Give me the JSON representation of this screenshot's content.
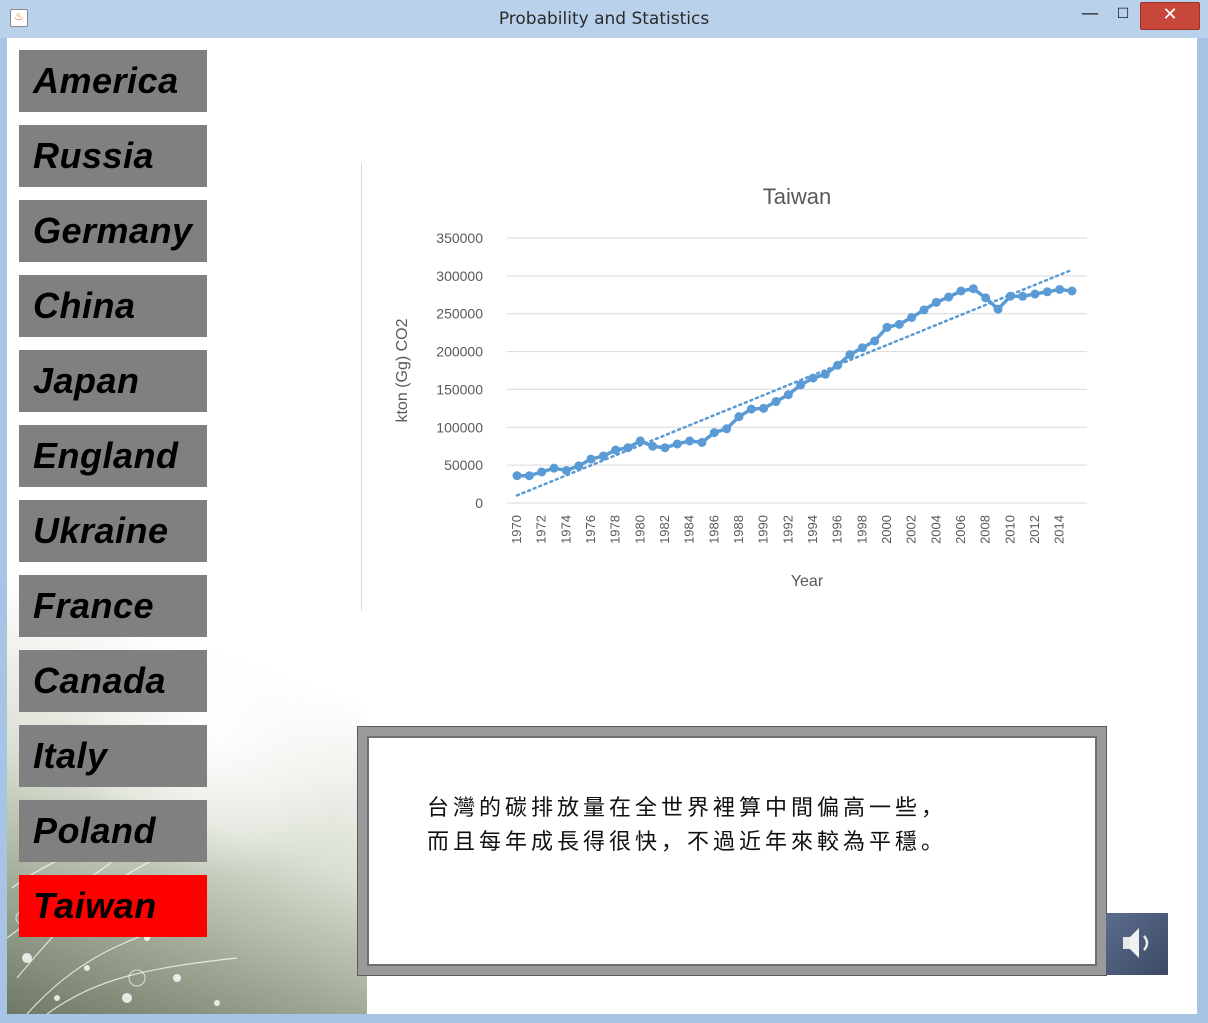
{
  "window": {
    "title": "Probability and Statistics",
    "icon": "java-cup-icon",
    "controls": {
      "minimize": "—",
      "maximize": "☐",
      "close": "✕"
    }
  },
  "sidebar": {
    "items": [
      {
        "label": "America",
        "active": false
      },
      {
        "label": "Russia",
        "active": false
      },
      {
        "label": "Germany",
        "active": false
      },
      {
        "label": "China",
        "active": false
      },
      {
        "label": "Japan",
        "active": false
      },
      {
        "label": "England",
        "active": false
      },
      {
        "label": "Ukraine",
        "active": false
      },
      {
        "label": "France",
        "active": false
      },
      {
        "label": "Canada",
        "active": false
      },
      {
        "label": "Italy",
        "active": false
      },
      {
        "label": "Poland",
        "active": false
      },
      {
        "label": "Taiwan",
        "active": true
      }
    ],
    "colors": {
      "default": "#808080",
      "active": "#ff0000"
    }
  },
  "chart_data": {
    "type": "line",
    "title": "Taiwan",
    "xlabel": "Year",
    "ylabel": "kton (Gg) CO2",
    "ylim": [
      0,
      350000
    ],
    "yticks": [
      0,
      50000,
      100000,
      150000,
      200000,
      250000,
      300000,
      350000
    ],
    "xtick_labels": [
      "1970",
      "1972",
      "1974",
      "1976",
      "1978",
      "1980",
      "1982",
      "1984",
      "1986",
      "1988",
      "1990",
      "1992",
      "1994",
      "1996",
      "1998",
      "2000",
      "2002",
      "2004",
      "2006",
      "2008",
      "2010",
      "2012",
      "2014"
    ],
    "grid": true,
    "color": "#5b9bd5",
    "series": [
      {
        "x": [
          1970,
          1971,
          1972,
          1973,
          1974,
          1975,
          1976,
          1977,
          1978,
          1979,
          1980,
          1981,
          1982,
          1983,
          1984,
          1985,
          1986,
          1987,
          1988,
          1989,
          1990,
          1991,
          1992,
          1993,
          1994,
          1995,
          1996,
          1997,
          1998,
          1999,
          2000,
          2001,
          2002,
          2003,
          2004,
          2005,
          2006,
          2007,
          2008,
          2009,
          2010,
          2011,
          2012,
          2013,
          2014,
          2015
        ],
        "values": [
          36000,
          36000,
          41000,
          46000,
          43000,
          49000,
          58000,
          62000,
          70000,
          73000,
          82000,
          75000,
          73000,
          78000,
          82000,
          80000,
          93000,
          98000,
          114000,
          124000,
          125000,
          134000,
          143000,
          156000,
          165000,
          170000,
          182000,
          196000,
          205000,
          214000,
          232000,
          236000,
          245000,
          255000,
          265000,
          272000,
          280000,
          283000,
          271000,
          256000,
          273000,
          273000,
          276000,
          279000,
          282000,
          280000
        ]
      }
    ],
    "trendline": {
      "style": "dotted",
      "x": [
        1970,
        2015
      ],
      "values": [
        10000,
        308000
      ]
    }
  },
  "description_box": {
    "lines": [
      "台灣的碳排放量在全世界裡算中間偏高一些，",
      "而且每年成長得很快，不過近年來較為平穩。"
    ]
  },
  "speaker_button": {
    "icon": "speaker-icon"
  }
}
